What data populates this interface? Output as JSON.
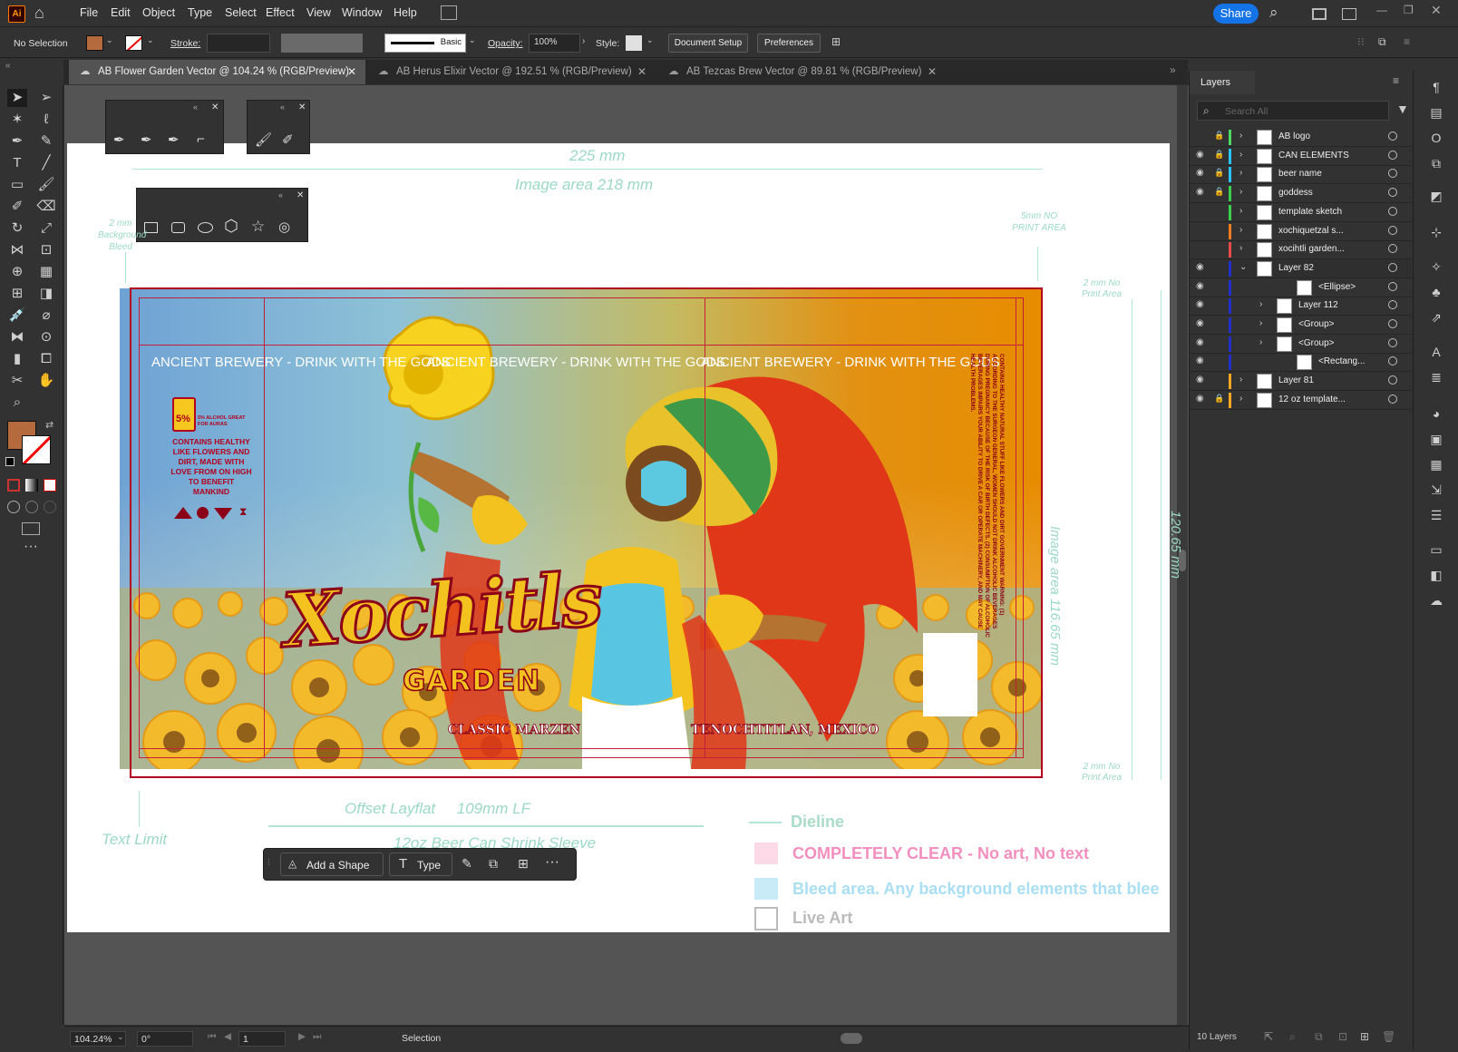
{
  "menu": {
    "app_icon": "Ai",
    "items": [
      "File",
      "Edit",
      "Object",
      "Type",
      "Select",
      "Effect",
      "View",
      "Window",
      "Help"
    ],
    "share_label": "Share"
  },
  "control": {
    "selection": "No Selection",
    "stroke_label": "Stroke:",
    "brush_label": "Basic",
    "opacity_label": "Opacity:",
    "opacity_value": "100%",
    "style_label": "Style:",
    "doc_setup": "Document Setup",
    "preferences": "Preferences"
  },
  "tabs": [
    {
      "label": "AB Flower Garden Vector @ 104.24 % (RGB/Preview)",
      "active": true
    },
    {
      "label": "AB Herus Elixir Vector @ 192.51 % (RGB/Preview)",
      "active": false
    },
    {
      "label": "AB Tezcas Brew Vector @ 89.81 % (RGB/Preview)",
      "active": false
    }
  ],
  "artboard": {
    "width_label": "225 mm",
    "image_area_label": "Image area 218 mm",
    "bleed_label": "2 mm Background Bleed",
    "no_print_top": "5mm NO PRINT AREA",
    "no_print_right_top": "2 mm No Print Area",
    "no_print_right_bottom": "2 mm No Print Area",
    "image_area_vertical": "Image area 116.65 mm",
    "height_label": "120.65 mm",
    "text_limit": "Text Limit",
    "offset_label": "Offset Layflat     109mm LF",
    "sleeve_label": "12oz Beer Can Shrink Sleeve",
    "legend": {
      "dieline": "Dieline",
      "clear": "COMPLETELY CLEAR - No art, No text",
      "bleed": "Bleed area. Any background elements that blee",
      "live": "Live Art"
    }
  },
  "label_art": {
    "banner": "ANCIENT BREWERY - DRINK WITH THE GODS",
    "abv": "5%",
    "alcohol_line": "5% ALCHOL GREAT FOR AURAS",
    "blurb": "CONTAINS HEALTHY LIKE FLOWERS AND DIRT, MADE WITH LOVE FROM ON HIGH TO BENEFIT MANKIND",
    "title": "Xochitls",
    "subtitle": "GARDEN",
    "style_name": "CLASSIC MARZEN",
    "origin": "TENOCHTITLAN, MEXICO",
    "warning": "CONTAINS HEALTHY NATURAL STUFF LIKE FLOWERS AND DIRT GOVERNMENT WARNING: (1) ACCORDING TO THE SURGEON GENERAL, WOMEN SHOULD NOT DRINK ALCOHOLIC BEVERAGES DURING PREGNANCY BECAUSE OF THE RISK OF BIRTH DEFECTS. (2) CONSUMPTION OF ALCOHOLIC BEVERAGES IMPAIRS YOUR ABILITY TO DRIVE A CAR OR OPERATE MACHINERY, AND MAY CAUSE HEALTH PROBLEMS."
  },
  "context_bar": {
    "add_shape": "Add a Shape",
    "type": "Type"
  },
  "status": {
    "zoom": "104.24%",
    "rotation": "0°",
    "artboard_num": "1",
    "mode": "Selection"
  },
  "layers": {
    "title": "Layers",
    "search_placeholder": "Search All",
    "count_label": "10 Layers",
    "rows": [
      {
        "name": "AB logo",
        "eye": false,
        "lock": true,
        "color": "#4cd964",
        "indent": 0,
        "arrow": "›"
      },
      {
        "name": "CAN ELEMENTS",
        "eye": true,
        "lock": true,
        "color": "#29c5f6",
        "indent": 0,
        "arrow": "›"
      },
      {
        "name": "beer name",
        "eye": true,
        "lock": true,
        "color": "#29c5f6",
        "indent": 0,
        "arrow": "›"
      },
      {
        "name": "goddess",
        "eye": true,
        "lock": true,
        "color": "#3ccf4e",
        "indent": 0,
        "arrow": "›"
      },
      {
        "name": "template sketch",
        "eye": false,
        "lock": false,
        "color": "#3ccf4e",
        "indent": 0,
        "arrow": "›"
      },
      {
        "name": "xochiquetzal s...",
        "eye": false,
        "lock": false,
        "color": "#f57c20",
        "indent": 0,
        "arrow": "›"
      },
      {
        "name": "xocihtli garden...",
        "eye": false,
        "lock": false,
        "color": "#e84c4c",
        "indent": 0,
        "arrow": "›"
      },
      {
        "name": "Layer 82",
        "eye": true,
        "lock": false,
        "color": "#2230c9",
        "indent": 0,
        "arrow": "⌄"
      },
      {
        "name": "<Ellipse>",
        "eye": true,
        "lock": false,
        "color": "#2230c9",
        "indent": 2,
        "arrow": ""
      },
      {
        "name": "Layer 112",
        "eye": true,
        "lock": false,
        "color": "#2230c9",
        "indent": 1,
        "arrow": "›"
      },
      {
        "name": "<Group>",
        "eye": true,
        "lock": false,
        "color": "#2230c9",
        "indent": 1,
        "arrow": "›"
      },
      {
        "name": "<Group>",
        "eye": true,
        "lock": false,
        "color": "#2230c9",
        "indent": 1,
        "arrow": "›"
      },
      {
        "name": "<Rectang...",
        "eye": true,
        "lock": false,
        "color": "#2230c9",
        "indent": 2,
        "arrow": ""
      },
      {
        "name": "Layer 81",
        "eye": true,
        "lock": false,
        "color": "#f5a623",
        "indent": 0,
        "arrow": "›"
      },
      {
        "name": "12 oz template...",
        "eye": true,
        "lock": true,
        "color": "#f5a623",
        "indent": 0,
        "arrow": "›"
      }
    ]
  },
  "colors": {
    "fill": "#b46a3c",
    "accent": "#1473e6",
    "guide": "#9bd9c4",
    "dieline": "#b2001f"
  }
}
